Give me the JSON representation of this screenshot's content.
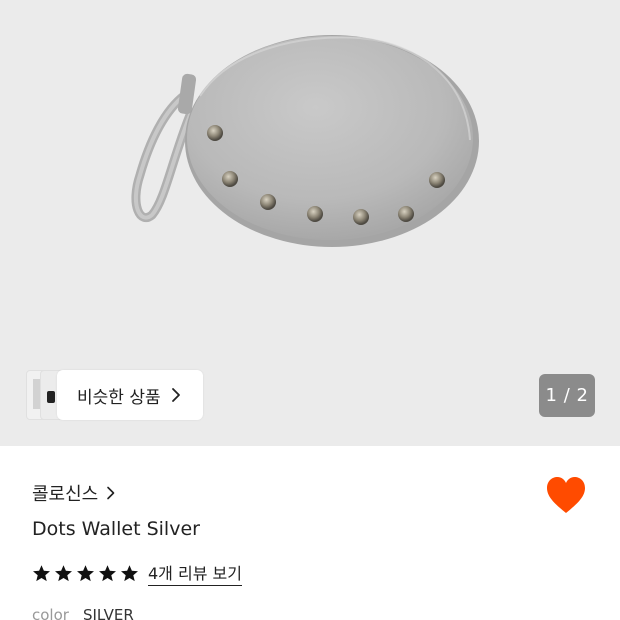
{
  "gallery": {
    "similar_label": "비슷한 상품",
    "page_counter": "1 / 2"
  },
  "product": {
    "brand": "콜로신스",
    "name": "Dots Wallet Silver",
    "rating": 5,
    "rating_max": 5,
    "review_link": "4개 리뷰 보기",
    "option_label": "color",
    "option_value": "SILVER"
  },
  "colors": {
    "hero_bg": "#ebebeb",
    "heart": "#ff4b00",
    "star": "#111111",
    "counter_bg": "#8b8b8b"
  },
  "icons": {
    "similar": "chevron-right-icon",
    "brand": "chevron-right-icon",
    "wishlist": "heart-icon",
    "rating": "star-icon"
  }
}
